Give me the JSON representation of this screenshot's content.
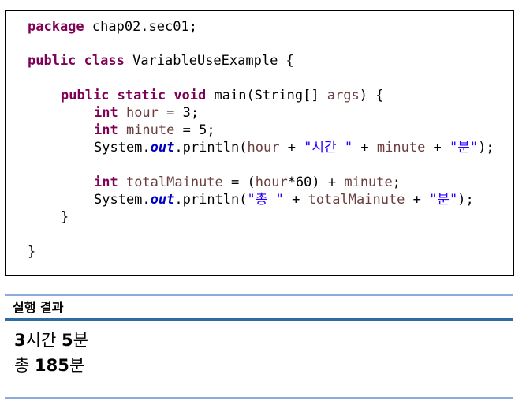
{
  "code": {
    "package_kw": "package",
    "package_name": " chap02.sec01;",
    "public_kw": "public",
    "class_kw": " class",
    "class_name": " VariableUseExample {",
    "main_public": "public",
    "main_static": " static",
    "main_void": " void",
    "main_sig_a": " main(String[] ",
    "main_args": "args",
    "main_sig_b": ") {",
    "int1": "int",
    "hour_decl_var": " hour",
    "hour_decl_rest": " = 3;",
    "int2": "int",
    "minute_decl_var": " minute",
    "minute_decl_rest": " = 5;",
    "sys1": "System.",
    "out1": "out",
    "println1": ".println(",
    "hour_ref": "hour",
    "plus1": " + ",
    "str_hour": "\"시간 \"",
    "plus2": " + ",
    "minute_ref": "minute",
    "plus3": " + ",
    "str_min1": "\"분\"",
    "end1": ");",
    "int3": "int",
    "total_decl_var": " totalMainute",
    "total_decl_a": " = (",
    "total_hour_ref": "hour",
    "total_decl_b": "*60) + ",
    "total_min_ref": "minute",
    "total_decl_c": ";",
    "sys2": "System.",
    "out2": "out",
    "println2": ".println(",
    "str_total": "\"총 \"",
    "plus4": " + ",
    "total_ref": "totalMainute",
    "plus5": " + ",
    "str_min2": "\"분\"",
    "end2": ");",
    "close_method": "}",
    "close_class": "}"
  },
  "result": {
    "title": "실행 결과",
    "line1_num1": "3",
    "line1_text1": "시간 ",
    "line1_num2": "5",
    "line1_text2": "분",
    "line2_text1": "총 ",
    "line2_num": "185",
    "line2_text2": "분"
  },
  "colors": {
    "keyword": "#7f0055",
    "variable": "#6a3e3e",
    "string": "#2a00ff",
    "static_field": "#0000c0",
    "result_rule_dark": "#2e6da4",
    "result_rule_light": "#8faadc"
  }
}
